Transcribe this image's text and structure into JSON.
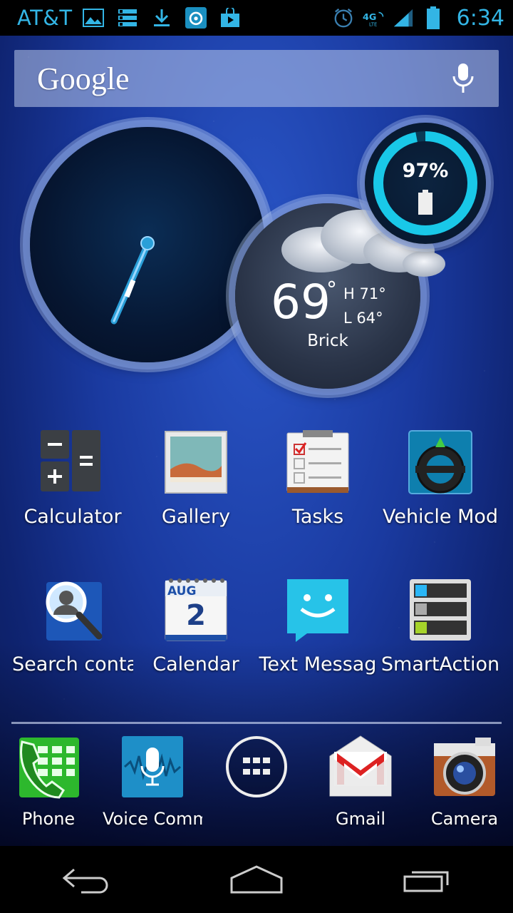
{
  "status_bar": {
    "carrier": "AT&T",
    "time": "6:34",
    "network": "4G LTE",
    "left_icons": [
      "gallery-icon",
      "settings-list-icon",
      "download-icon",
      "app-notification-icon",
      "play-store-icon"
    ],
    "right_icons": [
      "alarm-icon",
      "network-icon",
      "signal-icon",
      "battery-icon"
    ]
  },
  "search": {
    "logo": "Google",
    "mic_icon": "mic-icon"
  },
  "battery_widget": {
    "percent": "97%"
  },
  "weather": {
    "temp": "69",
    "high": "H 71°",
    "low": "L 64°",
    "location": "Brick",
    "degree": "°"
  },
  "apps": [
    {
      "label": "Calculator",
      "icon": "calculator-icon"
    },
    {
      "label": "Gallery",
      "icon": "gallery-icon"
    },
    {
      "label": "Tasks",
      "icon": "tasks-icon"
    },
    {
      "label": "Vehicle Mod",
      "icon": "vehicle-mode-icon"
    },
    {
      "label": "Search conta",
      "icon": "search-contacts-icon"
    },
    {
      "label": "Calendar",
      "icon": "calendar-icon"
    },
    {
      "label": "Text Messag",
      "icon": "messaging-icon"
    },
    {
      "label": "SmartAction",
      "icon": "smartactions-icon"
    }
  ],
  "calendar_icon": {
    "month": "AUG",
    "day": "2"
  },
  "dock": [
    {
      "label": "Phone",
      "icon": "phone-icon"
    },
    {
      "label": "Voice Comm",
      "icon": "voice-commands-icon"
    },
    {
      "label": "",
      "icon": "app-drawer-icon"
    },
    {
      "label": "Gmail",
      "icon": "gmail-icon"
    },
    {
      "label": "Camera",
      "icon": "camera-icon"
    }
  ],
  "nav": [
    "back-icon",
    "home-icon",
    "recent-apps-icon"
  ],
  "colors": {
    "status_accent": "#33b5e5"
  }
}
